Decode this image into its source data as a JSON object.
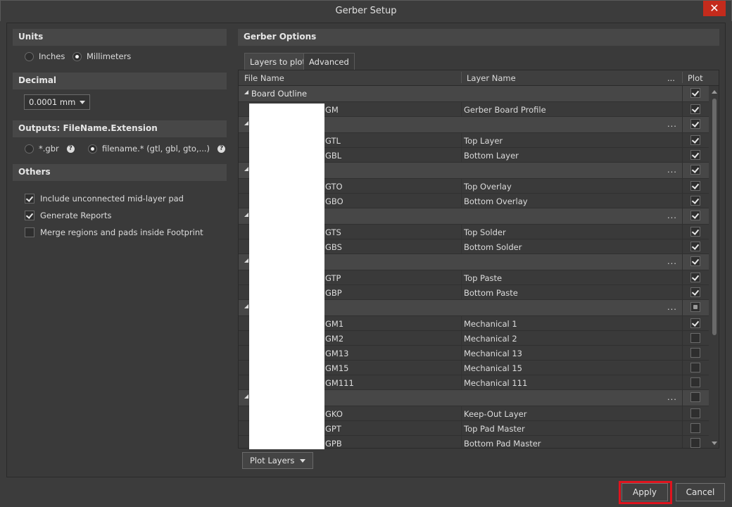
{
  "window": {
    "title": "Gerber Setup"
  },
  "icons": {
    "close": "close-icon",
    "help": "help-icon",
    "dropdown": "chevron-down-icon",
    "collapse": "collapse-triangle-icon"
  },
  "left": {
    "units": {
      "header": "Units",
      "options": [
        "Inches",
        "Millimeters"
      ],
      "selected": "Millimeters"
    },
    "decimal": {
      "header": "Decimal",
      "value": "0.0001 mm"
    },
    "outputs": {
      "header": "Outputs: FileName.Extension",
      "options": [
        "*.gbr",
        "filename.* (gtl, gbl, gto,...)"
      ],
      "selected": "filename.* (gtl, gbl, gto,...)"
    },
    "others": {
      "header": "Others",
      "items": [
        {
          "label": "Include unconnected mid-layer pad",
          "checked": true
        },
        {
          "label": "Generate Reports",
          "checked": true
        },
        {
          "label": "Merge regions and pads inside Footprint",
          "checked": false
        }
      ]
    }
  },
  "right": {
    "header": "Gerber Options",
    "tabs": [
      "Layers to plot",
      "Advanced"
    ],
    "active_tab": "Layers to plot",
    "columns": {
      "file": "File Name",
      "layer": "Layer Name",
      "more": "...",
      "plot": "Plot"
    },
    "groups": [
      {
        "name": "Board Outline",
        "plot": "checked",
        "rows": [
          {
            "file": "GM",
            "layer": "Gerber Board Profile",
            "plot": true
          }
        ]
      },
      {
        "name": "",
        "plot": "checked",
        "rows": [
          {
            "file": "GTL",
            "layer": "Top Layer",
            "plot": true
          },
          {
            "file": "GBL",
            "layer": "Bottom Layer",
            "plot": true
          }
        ]
      },
      {
        "name": "",
        "plot": "checked",
        "rows": [
          {
            "file": "GTO",
            "layer": "Top Overlay",
            "plot": true
          },
          {
            "file": "GBO",
            "layer": "Bottom Overlay",
            "plot": true
          }
        ]
      },
      {
        "name": "",
        "plot": "checked",
        "rows": [
          {
            "file": "GTS",
            "layer": "Top Solder",
            "plot": true
          },
          {
            "file": "GBS",
            "layer": "Bottom Solder",
            "plot": true
          }
        ]
      },
      {
        "name": "",
        "plot": "checked",
        "rows": [
          {
            "file": "GTP",
            "layer": "Top Paste",
            "plot": true
          },
          {
            "file": "GBP",
            "layer": "Bottom Paste",
            "plot": true
          }
        ]
      },
      {
        "name": "",
        "plot": "partial",
        "rows": [
          {
            "file": "GM1",
            "layer": "Mechanical 1",
            "plot": true
          },
          {
            "file": "GM2",
            "layer": "Mechanical 2",
            "plot": false
          },
          {
            "file": "GM13",
            "layer": "Mechanical 13",
            "plot": false
          },
          {
            "file": "GM15",
            "layer": "Mechanical 15",
            "plot": false
          },
          {
            "file": "GM111",
            "layer": "Mechanical 111",
            "plot": false
          }
        ]
      },
      {
        "name": "",
        "plot": "unchecked",
        "rows": [
          {
            "file": "GKO",
            "layer": "Keep-Out Layer",
            "plot": false
          },
          {
            "file": "GPT",
            "layer": "Top Pad Master",
            "plot": false
          },
          {
            "file": "GPB",
            "layer": "Bottom Pad Master",
            "plot": false
          }
        ]
      }
    ],
    "plot_layers_button": "Plot Layers"
  },
  "footer": {
    "apply": "Apply",
    "cancel": "Cancel"
  }
}
